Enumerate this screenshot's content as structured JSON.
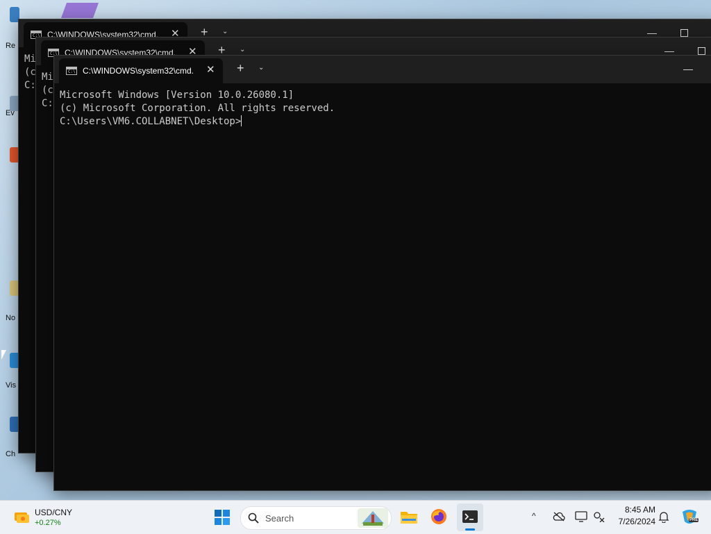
{
  "desktop": {
    "icon_labels": [
      "Re",
      "Ev",
      "No",
      "Vis",
      "Ch"
    ]
  },
  "windows": [
    {
      "tab_title": "C:\\WINDOWS\\system32\\cmd.",
      "console_lines": [
        "Mi",
        "(c",
        "",
        "C:"
      ]
    },
    {
      "tab_title": "C:\\WINDOWS\\system32\\cmd.",
      "console_lines": [
        "Mi",
        "(c",
        "",
        "C:"
      ]
    },
    {
      "tab_title": "C:\\WINDOWS\\system32\\cmd.",
      "console_lines": [
        "Microsoft Windows [Version 10.0.26080.1]",
        "(c) Microsoft Corporation. All rights reserved.",
        "",
        "C:\\Users\\VM6.COLLABNET\\Desktop>"
      ]
    }
  ],
  "titlebar_glyphs": {
    "close": "✕",
    "new_tab": "+",
    "dropdown": "⌄",
    "minimize": "—"
  },
  "icon_names": {
    "cmd": "C:\\"
  },
  "taskbar": {
    "widget": {
      "pair": "USD/CNY",
      "change": "+0.27%",
      "change_color": "#107c10"
    },
    "search_placeholder": "Search",
    "clock": {
      "time": "8:45 AM",
      "date": "7/26/2024"
    },
    "copilot_badge": "PRE"
  },
  "colors": {
    "console_bg": "#0c0c0c",
    "titlebar_bg": "#1f1f1f",
    "console_text": "#cccccc",
    "taskbar_bg": "#eef2f6",
    "accent": "#0078d4"
  }
}
